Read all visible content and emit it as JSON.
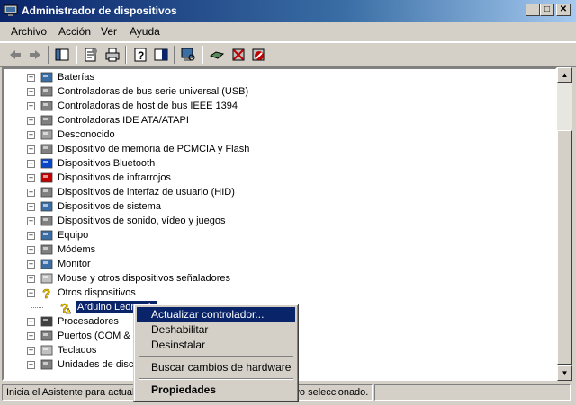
{
  "window": {
    "title": "Administrador de dispositivos",
    "buttons": [
      "_",
      "□",
      "✕"
    ]
  },
  "menubar": [
    "Archivo",
    "Acción",
    "Ver",
    "Ayuda"
  ],
  "toolbar": [
    "back-icon",
    "forward-icon",
    "properties-pane-icon",
    "properties-icon",
    "print-icon",
    "help-icon",
    "show-hide-tree-icon",
    "scan-hardware-icon",
    "update-driver-icon",
    "uninstall-icon",
    "disable-icon"
  ],
  "tree": {
    "items": [
      {
        "label": "Baterías",
        "icon": "battery-icon",
        "expander": "+"
      },
      {
        "label": "Controladoras de bus serie universal (USB)",
        "icon": "usb-icon",
        "expander": "+"
      },
      {
        "label": "Controladoras de host de bus IEEE 1394",
        "icon": "ieee1394-icon",
        "expander": "+"
      },
      {
        "label": "Controladoras IDE ATA/ATAPI",
        "icon": "ide-icon",
        "expander": "+"
      },
      {
        "label": "Desconocido",
        "icon": "unknown-icon",
        "expander": "+"
      },
      {
        "label": "Dispositivo de memoria de PCMCIA y Flash",
        "icon": "pcmcia-icon",
        "expander": "+"
      },
      {
        "label": "Dispositivos Bluetooth",
        "icon": "bluetooth-icon",
        "expander": "+"
      },
      {
        "label": "Dispositivos de infrarrojos",
        "icon": "infrared-icon",
        "expander": "+"
      },
      {
        "label": "Dispositivos de interfaz de usuario (HID)",
        "icon": "hid-icon",
        "expander": "+"
      },
      {
        "label": "Dispositivos de sistema",
        "icon": "system-icon",
        "expander": "+"
      },
      {
        "label": "Dispositivos de sonido, vídeo y juegos",
        "icon": "sound-icon",
        "expander": "+"
      },
      {
        "label": "Equipo",
        "icon": "computer-icon",
        "expander": "+"
      },
      {
        "label": "Módems",
        "icon": "modem-icon",
        "expander": "+"
      },
      {
        "label": "Monitor",
        "icon": "monitor-icon",
        "expander": "+"
      },
      {
        "label": "Mouse y otros dispositivos señaladores",
        "icon": "mouse-icon",
        "expander": "+"
      },
      {
        "label": "Otros dispositivos",
        "icon": "unknown-device-icon",
        "expander": "−"
      },
      {
        "label": "Arduino Leonardo",
        "icon": "warning-device-icon",
        "expander": "",
        "child": true,
        "selected": true
      },
      {
        "label": "Procesadores",
        "icon": "processor-icon",
        "expander": "+"
      },
      {
        "label": "Puertos (COM & LPT)",
        "icon": "port-icon",
        "expander": "+"
      },
      {
        "label": "Teclados",
        "icon": "keyboard-icon",
        "expander": "+"
      },
      {
        "label": "Unidades de disco",
        "icon": "disk-icon",
        "expander": "+"
      }
    ]
  },
  "status": {
    "left": "Inicia el Asistente para actualización de hardware para el dispositivo seleccionado.",
    "right": ""
  },
  "context_menu": {
    "items": [
      "Actualizar controlador...",
      "Deshabilitar",
      "Desinstalar",
      "Buscar cambios de hardware",
      "Propiedades"
    ]
  }
}
